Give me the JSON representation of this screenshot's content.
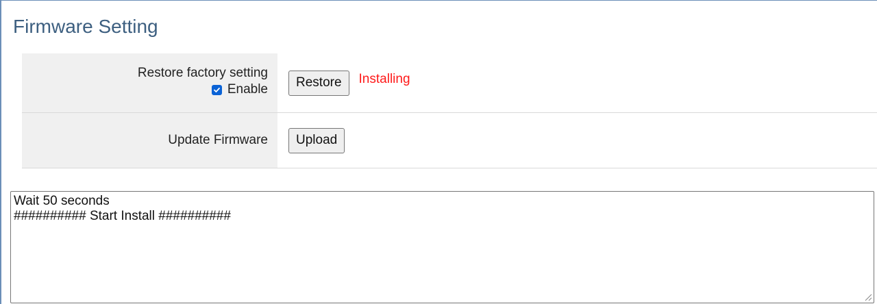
{
  "page": {
    "title": "Firmware Setting"
  },
  "restore": {
    "label": "Restore factory setting",
    "enable_label": "Enable",
    "enable_checked": true,
    "button_label": "Restore",
    "status": "Installing",
    "status_color": "#ff1a1a"
  },
  "update": {
    "label": "Update Firmware",
    "button_label": "Upload"
  },
  "log": {
    "lines": [
      "Wait 50 seconds",
      "########## Start Install ##########"
    ]
  },
  "colors": {
    "title": "#3d5f80",
    "label_background": "#f0f0f0",
    "checkbox": "#0b63d6"
  },
  "icons": {
    "checkbox": "checkmark-icon",
    "resize": "resize-grip-icon"
  }
}
